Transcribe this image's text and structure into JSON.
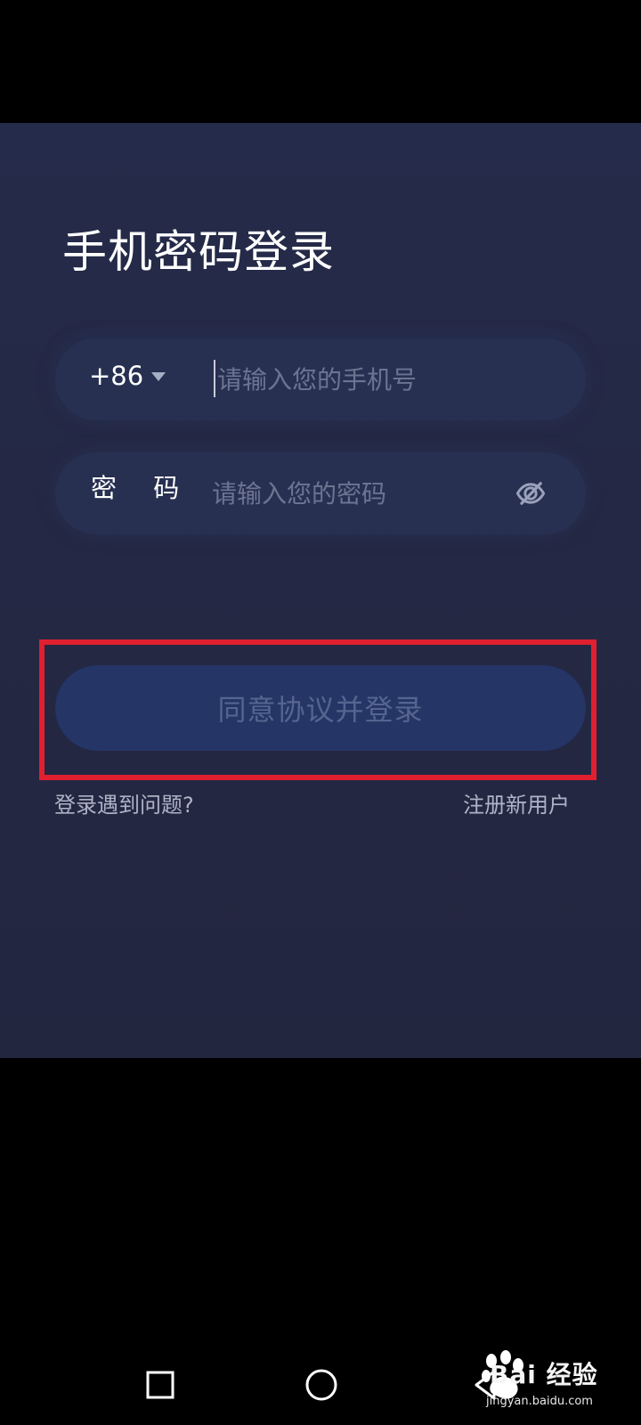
{
  "screen": {
    "title": "手机密码登录"
  },
  "phone": {
    "country_code": "+86",
    "placeholder": "请输入您的手机号",
    "value": ""
  },
  "password": {
    "label": "密 码",
    "placeholder": "请输入您的密码",
    "value": ""
  },
  "actions": {
    "login_label": "同意协议并登录",
    "help_label": "登录遇到问题?",
    "register_label": "注册新用户"
  },
  "watermark": {
    "brand": "Bai 经验",
    "sub": "jingyan.baidu.com"
  },
  "colors": {
    "panel": "#252b4a",
    "field": "#273051",
    "button": "#243566",
    "highlight": "#e0202f"
  },
  "icons": {
    "password_toggle": "eye-off-icon",
    "nav_recent": "square-icon",
    "nav_home": "circle-icon",
    "nav_back": "triangle-back-icon"
  }
}
